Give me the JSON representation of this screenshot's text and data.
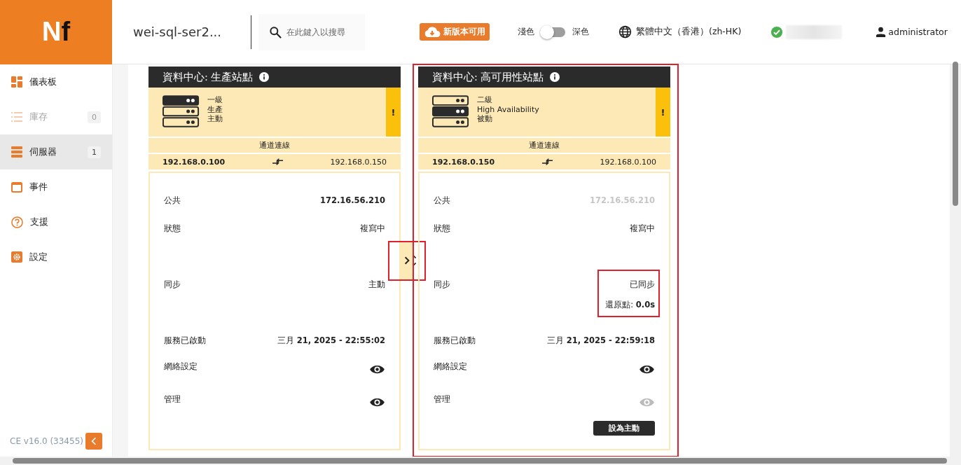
{
  "header": {
    "logo": "Nf",
    "server_name": "wei-sql-ser2...",
    "search": {
      "placeholder": "在此鍵入以搜尋"
    },
    "update_badge": "新版本可用",
    "theme": {
      "light_label": "淺色",
      "dark_label": "深色",
      "on": false
    },
    "language": "繁體中文（香港）(zh-HK)",
    "user": "administrator"
  },
  "sidebar": {
    "items": [
      {
        "label": "儀表板",
        "selected": false,
        "disabled": false
      },
      {
        "label": "庫存",
        "count": "0",
        "selected": false,
        "disabled": true
      },
      {
        "label": "伺服器",
        "count": "1",
        "selected": true,
        "disabled": false
      },
      {
        "label": "事件",
        "selected": false,
        "disabled": false
      },
      {
        "label": "支援",
        "selected": false,
        "disabled": false
      },
      {
        "label": "設定",
        "selected": false,
        "disabled": false
      }
    ],
    "version": "CE v16.0 (33455)"
  },
  "sites": [
    {
      "title": "資料中心: 生產站點",
      "highlighted": false,
      "units": [
        {
          "filled": true
        },
        {
          "filled": false
        },
        {
          "filled": false
        }
      ],
      "lines": [
        "一級",
        "生產",
        "主動"
      ],
      "warning": "!",
      "channel_label": "通道連線",
      "local_ip": "192.168.0.100",
      "remote_ip": "192.168.0.150",
      "rows": [
        {
          "kind": "text",
          "label": "公共",
          "value": "**172.16.56.210**",
          "dimmed": false
        },
        {
          "kind": "text",
          "label": "狀態",
          "value": "複寫中",
          "dimmed": false
        },
        {
          "kind": "text",
          "label": "同步",
          "value": "主動",
          "dimmed": false,
          "highlighted": false
        },
        {
          "kind": "text",
          "label": "服務已啟動",
          "value": "三月 **21, 2025 - 22:55:02**",
          "dimmed": false
        },
        {
          "kind": "eye",
          "label": "網絡設定",
          "disabled": false
        },
        {
          "kind": "eye",
          "label": "管理",
          "disabled": false
        }
      ]
    },
    {
      "title": "資料中心: 高可用性站點",
      "highlighted": true,
      "units": [
        {
          "filled": false
        },
        {
          "filled": true
        },
        {
          "filled": false
        }
      ],
      "lines": [
        "二級",
        "High Availability",
        "被動"
      ],
      "warning": "!",
      "channel_label": "通道連線",
      "local_ip": "192.168.0.150",
      "remote_ip": "192.168.0.100",
      "rows": [
        {
          "kind": "text",
          "label": "公共",
          "value": "**172.16.56.210**",
          "dimmed": true
        },
        {
          "kind": "text",
          "label": "狀態",
          "value": "複寫中",
          "dimmed": false
        },
        {
          "kind": "text",
          "label": "同步",
          "value": "已同步",
          "extra": "還原點: **0.0s**",
          "dimmed": false,
          "highlighted": true
        },
        {
          "kind": "text",
          "label": "服務已啟動",
          "value": "三月 **21, 2025 - 22:59:18**",
          "dimmed": false
        },
        {
          "kind": "eye",
          "label": "網絡設定",
          "disabled": false
        },
        {
          "kind": "eye",
          "label": "管理",
          "disabled": true
        }
      ],
      "button": "設為主動"
    }
  ],
  "switch_toggle": {
    "highlighted": true
  }
}
